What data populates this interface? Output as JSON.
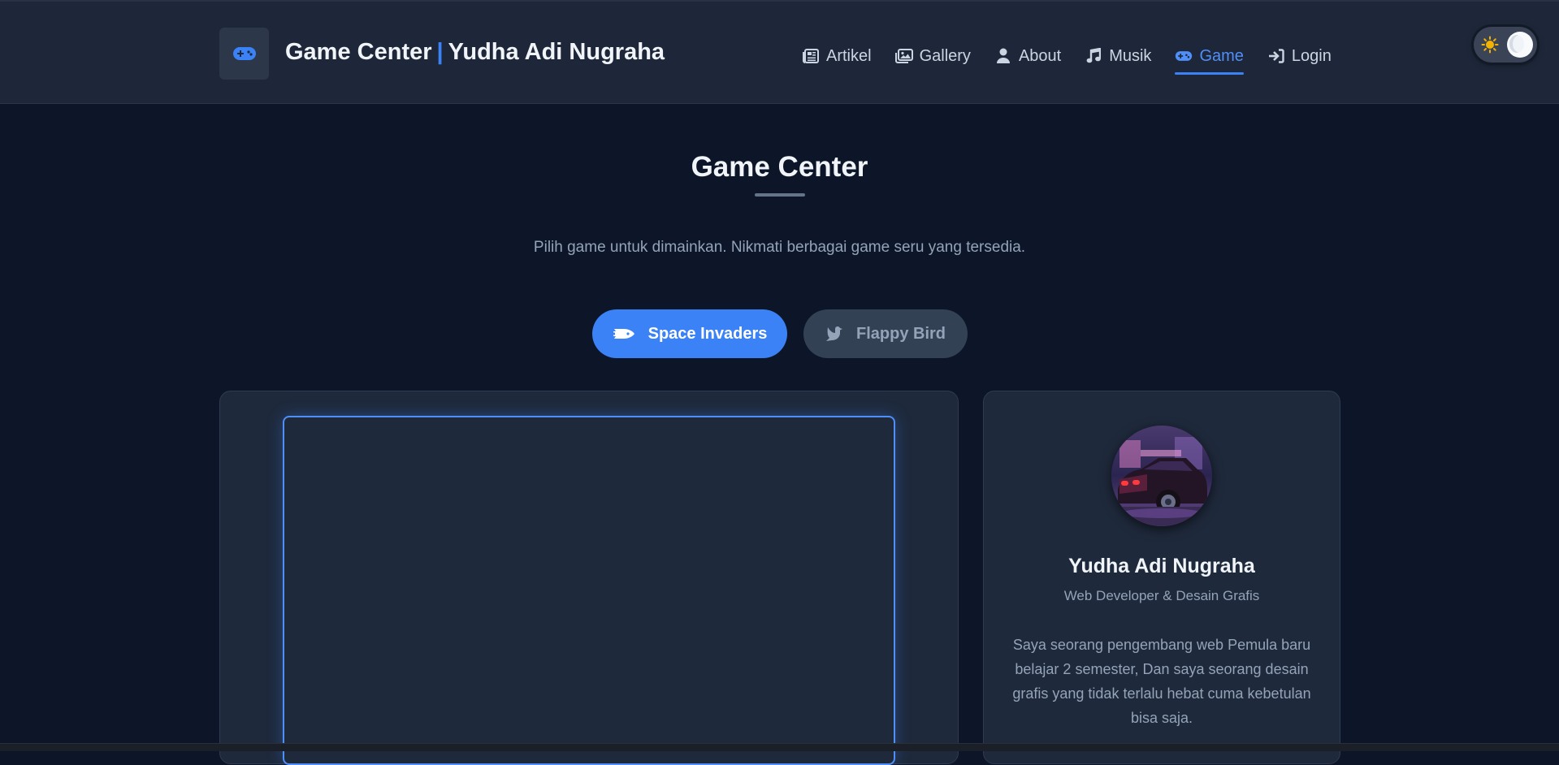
{
  "header": {
    "title_main": "Game Center",
    "title_sep": "|",
    "title_name": "Yudha Adi Nugraha",
    "logo_icon": "gamepad-icon"
  },
  "nav": {
    "items": [
      {
        "label": "Artikel",
        "icon": "newspaper-icon",
        "active": false
      },
      {
        "label": "Gallery",
        "icon": "images-icon",
        "active": false
      },
      {
        "label": "About",
        "icon": "user-icon",
        "active": false
      },
      {
        "label": "Musik",
        "icon": "music-icon",
        "active": false
      },
      {
        "label": "Game",
        "icon": "gamepad-icon",
        "active": true
      },
      {
        "label": "Login",
        "icon": "sign-in-icon",
        "active": false
      }
    ]
  },
  "theme_toggle": {
    "mode": "dark",
    "icons": [
      "sun-icon",
      "moon-icon"
    ]
  },
  "main": {
    "title": "Game Center",
    "subtitle": "Pilih game untuk dimainkan. Nikmati berbagai game seru yang tersedia.",
    "games": [
      {
        "label": "Space Invaders",
        "icon": "space-shuttle-icon",
        "selected": true
      },
      {
        "label": "Flappy Bird",
        "icon": "dove-icon",
        "selected": false
      }
    ]
  },
  "profile": {
    "name": "Yudha Adi Nugraha",
    "role": "Web Developer & Desain Grafis",
    "bio": "Saya seorang pengembang web Pemula baru belajar 2 semester, Dan saya seorang desain grafis yang tidak terlalu hebat cuma kebetulan bisa saja."
  },
  "colors": {
    "accent": "#3b82f6",
    "background": "#0c1628",
    "header_bg": "#1d2739",
    "card_bg": "#1e293b"
  }
}
